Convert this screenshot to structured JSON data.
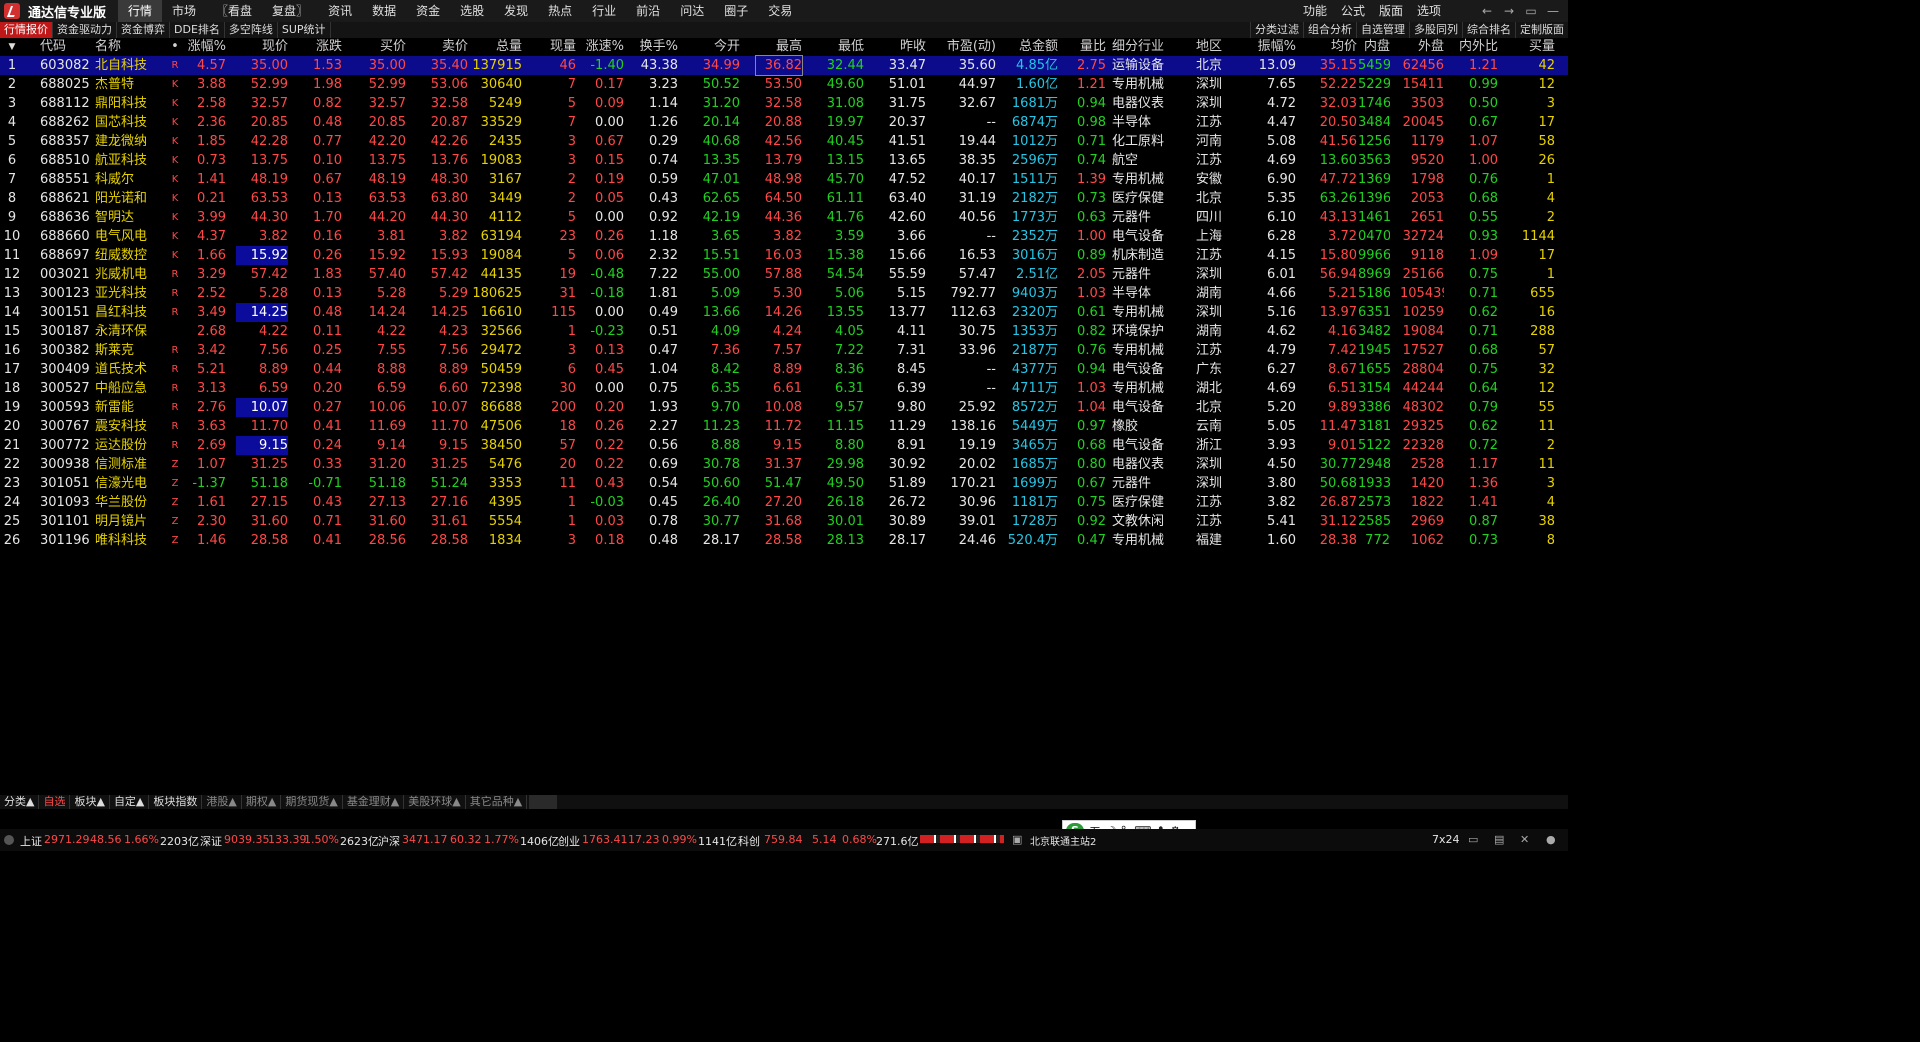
{
  "app": {
    "title": "通达信专业版"
  },
  "menu": [
    "行情",
    "市场",
    "〖看盘",
    "复盘〗",
    "资讯",
    "数据",
    "资金",
    "选股",
    "发现",
    "热点",
    "行业",
    "前沿",
    "问达",
    "圈子",
    "交易"
  ],
  "right_menu": [
    "功能",
    "公式",
    "版面",
    "选项"
  ],
  "window_controls": [
    "←",
    "→",
    "▭",
    "—"
  ],
  "toolbar_left": [
    "行情报价",
    "资金驱动力",
    "资金博弈",
    "DDE排名",
    "多空阵线",
    "SUP统计"
  ],
  "toolbar_right": [
    "分类过滤",
    "组合分析",
    "自选管理",
    "多股同列",
    "综合排名",
    "定制版面"
  ],
  "columns": [
    "",
    "代码",
    "名称",
    "•",
    "涨幅%",
    "现价",
    "涨跌",
    "买价",
    "卖价",
    "总量",
    "现量",
    "涨速%",
    "换手%",
    "今开",
    "最高",
    "最低",
    "昨收",
    "市盈(动)",
    "总金额",
    "量比",
    "细分行业",
    "地区",
    "振幅%",
    "均价",
    "内盘",
    "外盘",
    "内外比",
    "买量"
  ],
  "rows": [
    [
      "1",
      "603082",
      "北自科技",
      "R",
      "4.57",
      "35.00",
      "1.53",
      "35.00",
      "35.40",
      "137915",
      "46",
      "-1.40",
      "43.38",
      "34.99",
      "36.82",
      "32.44",
      "33.47",
      "35.60",
      "4.85亿",
      "2.75",
      "运输设备",
      "北京",
      "13.09",
      "35.15",
      "5459",
      "62456",
      "1.21",
      "42"
    ],
    [
      "2",
      "688025",
      "杰普特",
      "K",
      "3.88",
      "52.99",
      "1.98",
      "52.99",
      "53.06",
      "30640",
      "7",
      "0.17",
      "3.23",
      "50.52",
      "53.50",
      "49.60",
      "51.01",
      "44.97",
      "1.60亿",
      "1.21",
      "专用机械",
      "深圳",
      "7.65",
      "52.22",
      "5229",
      "15411",
      "0.99",
      "12"
    ],
    [
      "3",
      "688112",
      "鼎阳科技",
      "K",
      "2.58",
      "32.57",
      "0.82",
      "32.57",
      "32.58",
      "5249",
      "5",
      "0.09",
      "1.14",
      "31.20",
      "32.58",
      "31.08",
      "31.75",
      "32.67",
      "1681万",
      "0.94",
      "电器仪表",
      "深圳",
      "4.72",
      "32.03",
      "1746",
      "3503",
      "0.50",
      "3"
    ],
    [
      "4",
      "688262",
      "国芯科技",
      "K",
      "2.36",
      "20.85",
      "0.48",
      "20.85",
      "20.87",
      "33529",
      "7",
      "0.00",
      "1.26",
      "20.14",
      "20.88",
      "19.97",
      "20.37",
      "--",
      "6874万",
      "0.98",
      "半导体",
      "江苏",
      "4.47",
      "20.50",
      "3484",
      "20045",
      "0.67",
      "17"
    ],
    [
      "5",
      "688357",
      "建龙微纳",
      "K",
      "1.85",
      "42.28",
      "0.77",
      "42.20",
      "42.26",
      "2435",
      "3",
      "0.67",
      "0.29",
      "40.68",
      "42.56",
      "40.45",
      "41.51",
      "19.44",
      "1012万",
      "0.71",
      "化工原料",
      "河南",
      "5.08",
      "41.56",
      "1256",
      "1179",
      "1.07",
      "58"
    ],
    [
      "6",
      "688510",
      "航亚科技",
      "K",
      "0.73",
      "13.75",
      "0.10",
      "13.75",
      "13.76",
      "19083",
      "3",
      "0.15",
      "0.74",
      "13.35",
      "13.79",
      "13.15",
      "13.65",
      "38.35",
      "2596万",
      "0.74",
      "航空",
      "江苏",
      "4.69",
      "13.60",
      "3563",
      "9520",
      "1.00",
      "26"
    ],
    [
      "7",
      "688551",
      "科威尔",
      "K",
      "1.41",
      "48.19",
      "0.67",
      "48.19",
      "48.30",
      "3167",
      "2",
      "0.19",
      "0.59",
      "47.01",
      "48.98",
      "45.70",
      "47.52",
      "40.17",
      "1511万",
      "1.39",
      "专用机械",
      "安徽",
      "6.90",
      "47.72",
      "1369",
      "1798",
      "0.76",
      "1"
    ],
    [
      "8",
      "688621",
      "阳光诺和",
      "K",
      "0.21",
      "63.53",
      "0.13",
      "63.53",
      "63.80",
      "3449",
      "2",
      "0.05",
      "0.43",
      "62.65",
      "64.50",
      "61.11",
      "63.40",
      "31.19",
      "2182万",
      "0.73",
      "医疗保健",
      "北京",
      "5.35",
      "63.26",
      "1396",
      "2053",
      "0.68",
      "4"
    ],
    [
      "9",
      "688636",
      "智明达",
      "K",
      "3.99",
      "44.30",
      "1.70",
      "44.20",
      "44.30",
      "4112",
      "5",
      "0.00",
      "0.92",
      "42.19",
      "44.36",
      "41.76",
      "42.60",
      "40.56",
      "1773万",
      "0.63",
      "元器件",
      "四川",
      "6.10",
      "43.13",
      "1461",
      "2651",
      "0.55",
      "2"
    ],
    [
      "10",
      "688660",
      "电气风电",
      "K",
      "4.37",
      "3.82",
      "0.16",
      "3.81",
      "3.82",
      "63194",
      "23",
      "0.26",
      "1.18",
      "3.65",
      "3.82",
      "3.59",
      "3.66",
      "--",
      "2352万",
      "1.00",
      "电气设备",
      "上海",
      "6.28",
      "3.72",
      "0470",
      "32724",
      "0.93",
      "1144"
    ],
    [
      "11",
      "688697",
      "纽威数控",
      "K",
      "1.66",
      "15.92",
      "0.26",
      "15.92",
      "15.93",
      "19084",
      "5",
      "0.06",
      "2.32",
      "15.51",
      "16.03",
      "15.38",
      "15.66",
      "16.53",
      "3016万",
      "0.89",
      "机床制造",
      "江苏",
      "4.15",
      "15.80",
      "9966",
      "9118",
      "1.09",
      "17"
    ],
    [
      "12",
      "003021",
      "兆威机电",
      "R",
      "3.29",
      "57.42",
      "1.83",
      "57.40",
      "57.42",
      "44135",
      "19",
      "-0.48",
      "7.22",
      "55.00",
      "57.88",
      "54.54",
      "55.59",
      "57.47",
      "2.51亿",
      "2.05",
      "元器件",
      "深圳",
      "6.01",
      "56.94",
      "8969",
      "25166",
      "0.75",
      "1"
    ],
    [
      "13",
      "300123",
      "亚光科技",
      "R",
      "2.52",
      "5.28",
      "0.13",
      "5.28",
      "5.29",
      "180625",
      "31",
      "-0.18",
      "1.81",
      "5.09",
      "5.30",
      "5.06",
      "5.15",
      "792.77",
      "9403万",
      "1.03",
      "半导体",
      "湖南",
      "4.66",
      "5.21",
      "5186",
      "105439",
      "0.71",
      "655"
    ],
    [
      "14",
      "300151",
      "昌红科技",
      "R",
      "3.49",
      "14.25",
      "0.48",
      "14.24",
      "14.25",
      "16610",
      "115",
      "0.00",
      "0.49",
      "13.66",
      "14.26",
      "13.55",
      "13.77",
      "112.63",
      "2320万",
      "0.61",
      "专用机械",
      "深圳",
      "5.16",
      "13.97",
      "6351",
      "10259",
      "0.62",
      "16"
    ],
    [
      "15",
      "300187",
      "永清环保",
      "",
      "2.68",
      "4.22",
      "0.11",
      "4.22",
      "4.23",
      "32566",
      "1",
      "-0.23",
      "0.51",
      "4.09",
      "4.24",
      "4.05",
      "4.11",
      "30.75",
      "1353万",
      "0.82",
      "环境保护",
      "湖南",
      "4.62",
      "4.16",
      "3482",
      "19084",
      "0.71",
      "288"
    ],
    [
      "16",
      "300382",
      "斯莱克",
      "R",
      "3.42",
      "7.56",
      "0.25",
      "7.55",
      "7.56",
      "29472",
      "3",
      "0.13",
      "0.47",
      "7.36",
      "7.57",
      "7.22",
      "7.31",
      "33.96",
      "2187万",
      "0.76",
      "专用机械",
      "江苏",
      "4.79",
      "7.42",
      "1945",
      "17527",
      "0.68",
      "57"
    ],
    [
      "17",
      "300409",
      "道氏技术",
      "R",
      "5.21",
      "8.89",
      "0.44",
      "8.88",
      "8.89",
      "50459",
      "6",
      "0.45",
      "1.04",
      "8.42",
      "8.89",
      "8.36",
      "8.45",
      "--",
      "4377万",
      "0.94",
      "电气设备",
      "广东",
      "6.27",
      "8.67",
      "1655",
      "28804",
      "0.75",
      "32"
    ],
    [
      "18",
      "300527",
      "中船应急",
      "R",
      "3.13",
      "6.59",
      "0.20",
      "6.59",
      "6.60",
      "72398",
      "30",
      "0.00",
      "0.75",
      "6.35",
      "6.61",
      "6.31",
      "6.39",
      "--",
      "4711万",
      "1.03",
      "专用机械",
      "湖北",
      "4.69",
      "6.51",
      "3154",
      "44244",
      "0.64",
      "12"
    ],
    [
      "19",
      "300593",
      "新雷能",
      "R",
      "2.76",
      "10.07",
      "0.27",
      "10.06",
      "10.07",
      "86688",
      "200",
      "0.20",
      "1.93",
      "9.70",
      "10.08",
      "9.57",
      "9.80",
      "25.92",
      "8572万",
      "1.04",
      "电气设备",
      "北京",
      "5.20",
      "9.89",
      "3386",
      "48302",
      "0.79",
      "55"
    ],
    [
      "20",
      "300767",
      "震安科技",
      "R",
      "3.63",
      "11.70",
      "0.41",
      "11.69",
      "11.70",
      "47506",
      "18",
      "0.26",
      "2.27",
      "11.23",
      "11.72",
      "11.15",
      "11.29",
      "138.16",
      "5449万",
      "0.97",
      "橡胶",
      "云南",
      "5.05",
      "11.47",
      "3181",
      "29325",
      "0.62",
      "11"
    ],
    [
      "21",
      "300772",
      "运达股份",
      "R",
      "2.69",
      "9.15",
      "0.24",
      "9.14",
      "9.15",
      "38450",
      "57",
      "0.22",
      "0.56",
      "8.88",
      "9.15",
      "8.80",
      "8.91",
      "19.19",
      "3465万",
      "0.68",
      "电气设备",
      "浙江",
      "3.93",
      "9.01",
      "5122",
      "22328",
      "0.72",
      "2"
    ],
    [
      "22",
      "300938",
      "信测标准",
      "Z",
      "1.07",
      "31.25",
      "0.33",
      "31.20",
      "31.25",
      "5476",
      "20",
      "0.22",
      "0.69",
      "30.78",
      "31.37",
      "29.98",
      "30.92",
      "20.02",
      "1685万",
      "0.80",
      "电器仪表",
      "深圳",
      "4.50",
      "30.77",
      "2948",
      "2528",
      "1.17",
      "11"
    ],
    [
      "23",
      "301051",
      "信濠光电",
      "Z",
      "-1.37",
      "51.18",
      "-0.71",
      "51.18",
      "51.24",
      "3353",
      "11",
      "0.43",
      "0.54",
      "50.60",
      "51.47",
      "49.50",
      "51.89",
      "170.21",
      "1699万",
      "0.67",
      "元器件",
      "深圳",
      "3.80",
      "50.68",
      "1933",
      "1420",
      "1.36",
      "3"
    ],
    [
      "24",
      "301093",
      "华兰股份",
      "Z",
      "1.61",
      "27.15",
      "0.43",
      "27.13",
      "27.16",
      "4395",
      "1",
      "-0.03",
      "0.45",
      "26.40",
      "27.20",
      "26.18",
      "26.72",
      "30.96",
      "1181万",
      "0.75",
      "医疗保健",
      "江苏",
      "3.82",
      "26.87",
      "2573",
      "1822",
      "1.41",
      "4"
    ],
    [
      "25",
      "301101",
      "明月镜片",
      "Z",
      "2.30",
      "31.60",
      "0.71",
      "31.60",
      "31.61",
      "5554",
      "1",
      "0.03",
      "0.78",
      "30.77",
      "31.68",
      "30.01",
      "30.89",
      "39.01",
      "1728万",
      "0.92",
      "文教休闲",
      "江苏",
      "5.41",
      "31.12",
      "2585",
      "2969",
      "0.87",
      "38"
    ],
    [
      "26",
      "301196",
      "唯科科技",
      "Z",
      "1.46",
      "28.58",
      "0.41",
      "28.56",
      "28.58",
      "1834",
      "3",
      "0.18",
      "0.48",
      "28.17",
      "28.58",
      "28.13",
      "28.17",
      "24.46",
      "520.4万",
      "0.47",
      "专用机械",
      "福建",
      "1.60",
      "28.38",
      "772",
      "1062",
      "0.73",
      "8"
    ]
  ],
  "bottom_tabs": [
    "分类▲",
    "自选",
    "板块▲",
    "自定▲",
    "板块指数",
    "港股▲",
    "期权▲",
    "期货现货▲",
    "基金理财▲",
    "美股环球▲",
    "其它品种▲"
  ],
  "status": {
    "sh_label": "上证",
    "sh_val": "2971.29",
    "sh_chg": "48.56",
    "sh_pct": "1.66%",
    "sh_amt": "2203亿",
    "sz_label": "深证",
    "sz_val": "9039.35",
    "sz_chg": "133.39",
    "sz_pct": "1.50%",
    "sz_amt": "2623亿",
    "hs_label": "沪深",
    "hs_val": "3471.17",
    "hs_chg": "60.32",
    "hs_pct": "1.77%",
    "hs_amt": "1406亿",
    "cy_label": "创业",
    "cy_val": "1763.41",
    "cy_chg": "17.23",
    "cy_pct": "0.99%",
    "cy_amt": "1141亿",
    "kc_label": "科创",
    "kc_val": "759.84",
    "kc_chg": "5.14",
    "kc_pct": "0.68%",
    "kc_amt": "271.6亿",
    "server": "北京联通主站2",
    "session": "7x24"
  },
  "ime": {
    "logo": "S",
    "mode": "五",
    "icons": "☽ °, ⌨ ♣ ⚙"
  },
  "colors": {
    "up": "#ff4848",
    "down": "#22d022",
    "flat": "#e6e6e6",
    "volume": "#e6d200",
    "amount": "#26c6e6",
    "selected": "#0b0b8c"
  }
}
